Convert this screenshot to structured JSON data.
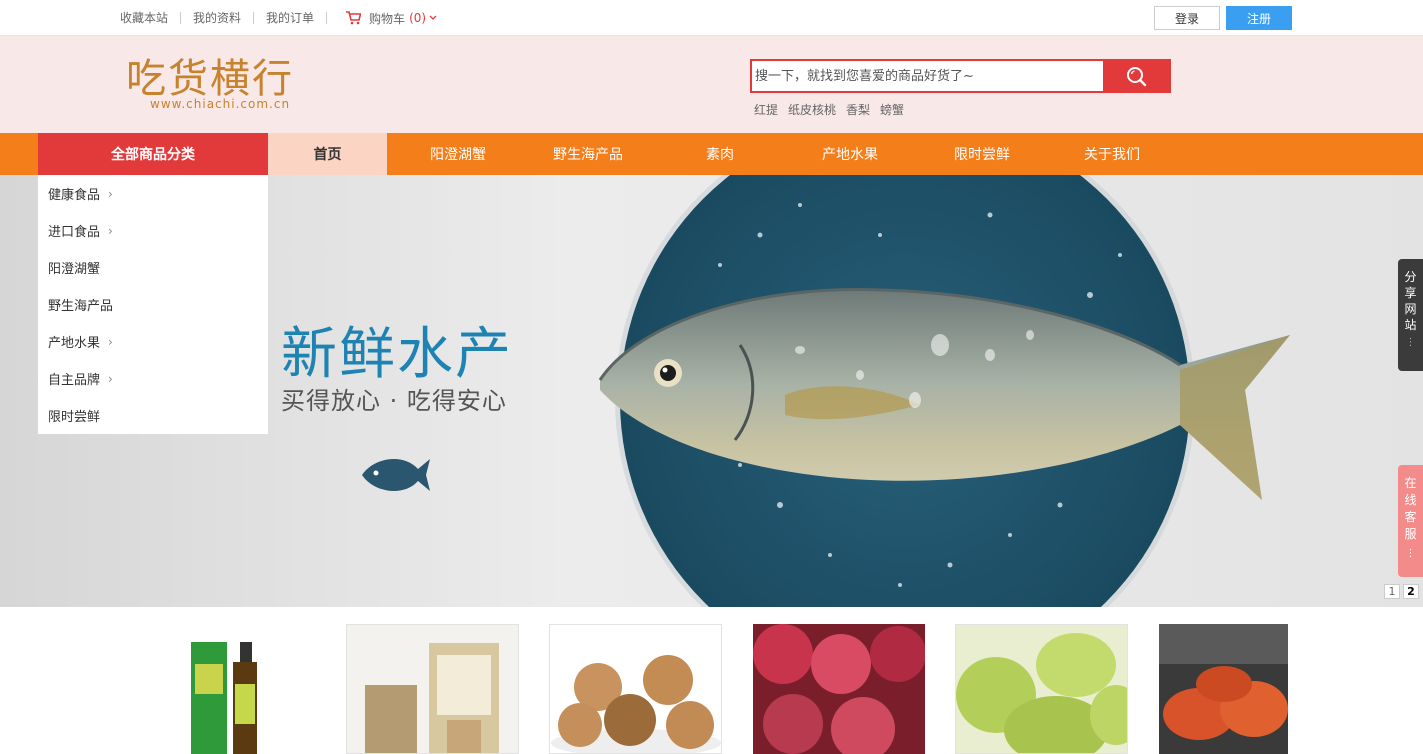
{
  "topbar": {
    "links": [
      "收藏本站",
      "我的资料",
      "我的订单"
    ],
    "cart_label": "购物车",
    "cart_count": "(0)",
    "login": "登录",
    "register": "注册"
  },
  "header": {
    "logo_text": "吃货横行",
    "logo_url": "www.chiachi.com.cn",
    "search_placeholder": "搜一下，就找到您喜爱的商品好货了~",
    "hot_words": [
      "红提",
      "纸皮核桃",
      "香梨",
      "螃蟹"
    ]
  },
  "nav": {
    "all_categories": "全部商品分类",
    "items": [
      "首页",
      "阳澄湖蟹",
      "野生海产品",
      "素肉",
      "产地水果",
      "限时尝鲜",
      "关于我们"
    ]
  },
  "categories": [
    {
      "label": "健康食品",
      "has_sub": true
    },
    {
      "label": "进口食品",
      "has_sub": true
    },
    {
      "label": "阳澄湖蟹",
      "has_sub": false
    },
    {
      "label": "野生海产品",
      "has_sub": false
    },
    {
      "label": "产地水果",
      "has_sub": true
    },
    {
      "label": "自主品牌",
      "has_sub": true
    },
    {
      "label": "限时尝鲜",
      "has_sub": false
    }
  ],
  "banner": {
    "title": "新鲜水产",
    "subtitle": "买得放心 · 吃得安心",
    "pages": [
      "1",
      "2"
    ]
  },
  "float": {
    "share": "分享网站",
    "service": "在线客服"
  },
  "colors": {
    "red": "#e23a3a",
    "orange": "#f47e1a",
    "blue_btn": "#3a9ff0",
    "banner_blue": "#1d83b3"
  }
}
